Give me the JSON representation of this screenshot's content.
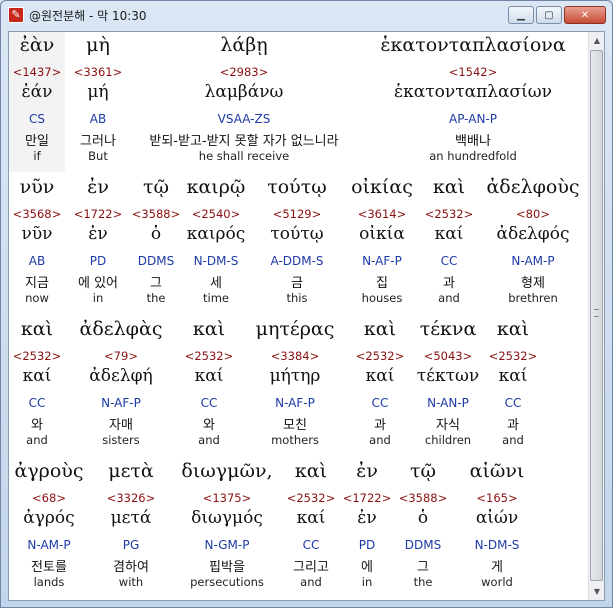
{
  "window": {
    "title": "@원전분해 - 막 10:30",
    "icon": "app-logo-icon",
    "buttons": {
      "minimize": "minimize-icon",
      "maximize": "maximize-icon",
      "close": "close-icon"
    }
  },
  "rows": [
    [
      {
        "greek": "ἐὰν",
        "num": "<1437>",
        "lemma": "ἐάν",
        "gram": "CS",
        "korean": "만일",
        "english": "if"
      },
      {
        "greek": "μὴ",
        "num": "<3361>",
        "lemma": "μή",
        "gram": "AB",
        "korean": "그러나",
        "english": "But"
      },
      {
        "greek": "λάβῃ",
        "num": "<2983>",
        "lemma": "λαμβάνω",
        "gram": "VSAA-ZS",
        "korean": "받되-받고-받지 못할 자가 없느니라",
        "english": "he shall receive"
      },
      {
        "greek": "ἑκατονταπλασίονα",
        "num": "<1542>",
        "lemma": "ἑκατονταπλασίων",
        "gram": "AP-AN-P",
        "korean": "백배나",
        "english": "an hundredfold"
      }
    ],
    [
      {
        "greek": "νῦν",
        "num": "<3568>",
        "lemma": "νῦν",
        "gram": "AB",
        "korean": "지금",
        "english": "now"
      },
      {
        "greek": "ἐν",
        "num": "<1722>",
        "lemma": "ἐν",
        "gram": "PD",
        "korean": "에 있어",
        "english": "in"
      },
      {
        "greek": "τῷ",
        "num": "<3588>",
        "lemma": "ὁ",
        "gram": "DDMS",
        "korean": "그",
        "english": "the"
      },
      {
        "greek": "καιρῷ",
        "num": "<2540>",
        "lemma": "καιρός",
        "gram": "N-DM-S",
        "korean": "세",
        "english": "time"
      },
      {
        "greek": "τούτῳ",
        "num": "<5129>",
        "lemma": "τούτῳ",
        "gram": "A-DDM-S",
        "korean": "금",
        "english": "this"
      },
      {
        "greek": "οἰκίας",
        "num": "<3614>",
        "lemma": "οἰκία",
        "gram": "N-AF-P",
        "korean": "집",
        "english": "houses"
      },
      {
        "greek": "καὶ",
        "num": "<2532>",
        "lemma": "καί",
        "gram": "CC",
        "korean": "과",
        "english": "and"
      },
      {
        "greek": "ἀδελφοὺς",
        "num": "<80>",
        "lemma": "ἀδελφός",
        "gram": "N-AM-P",
        "korean": "형제",
        "english": "brethren"
      }
    ],
    [
      {
        "greek": "καὶ",
        "num": "<2532>",
        "lemma": "καί",
        "gram": "CC",
        "korean": "와",
        "english": "and"
      },
      {
        "greek": "ἀδελφὰς",
        "num": "<79>",
        "lemma": "ἀδελφή",
        "gram": "N-AF-P",
        "korean": "자매",
        "english": "sisters"
      },
      {
        "greek": "καὶ",
        "num": "<2532>",
        "lemma": "καί",
        "gram": "CC",
        "korean": "와",
        "english": "and"
      },
      {
        "greek": "μητέρας",
        "num": "<3384>",
        "lemma": "μήτηρ",
        "gram": "N-AF-P",
        "korean": "모친",
        "english": "mothers"
      },
      {
        "greek": "καὶ",
        "num": "<2532>",
        "lemma": "καί",
        "gram": "CC",
        "korean": "과",
        "english": "and"
      },
      {
        "greek": "τέκνα",
        "num": "<5043>",
        "lemma": "τέκτων",
        "gram": "N-AN-P",
        "korean": "자식",
        "english": "children"
      },
      {
        "greek": "καὶ",
        "num": "<2532>",
        "lemma": "καί",
        "gram": "CC",
        "korean": "과",
        "english": "and"
      }
    ],
    [
      {
        "greek": "ἀγροὺς",
        "num": "<68>",
        "lemma": "ἀγρός",
        "gram": "N-AM-P",
        "korean": "전토를",
        "english": "lands"
      },
      {
        "greek": "μετὰ",
        "num": "<3326>",
        "lemma": "μετά",
        "gram": "PG",
        "korean": "겸하여",
        "english": "with"
      },
      {
        "greek": "διωγμῶν,",
        "num": "<1375>",
        "lemma": "διωγμός",
        "gram": "N-GM-P",
        "korean": "핍박을",
        "english": "persecutions"
      },
      {
        "greek": "καὶ",
        "num": "<2532>",
        "lemma": "καί",
        "gram": "CC",
        "korean": "그리고",
        "english": "and"
      },
      {
        "greek": "ἐν",
        "num": "<1722>",
        "lemma": "ἐν",
        "gram": "PD",
        "korean": "에",
        "english": "in"
      },
      {
        "greek": "τῷ",
        "num": "<3588>",
        "lemma": "ὁ",
        "gram": "DDMS",
        "korean": "그",
        "english": "the"
      },
      {
        "greek": "αἰῶνι",
        "num": "<165>",
        "lemma": "αἰών",
        "gram": "N-DM-S",
        "korean": "게",
        "english": "world"
      }
    ]
  ],
  "scrollbar": {
    "up": "scroll-up-arrow-icon",
    "down": "scroll-down-arrow-icon"
  }
}
